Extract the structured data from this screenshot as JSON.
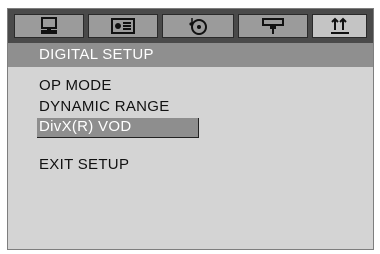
{
  "tabs": [
    {
      "name": "general-setup",
      "icon": "monitor-icon",
      "active": false
    },
    {
      "name": "audio-setup",
      "icon": "speaker-settings-icon",
      "active": false
    },
    {
      "name": "dolby-setup",
      "icon": "disc-music-icon",
      "active": false
    },
    {
      "name": "video-setup",
      "icon": "projector-icon",
      "active": false
    },
    {
      "name": "digital-setup",
      "icon": "arrows-adjust-icon",
      "active": true
    }
  ],
  "header": {
    "title": "DIGITAL SETUP"
  },
  "menu": {
    "items": [
      {
        "label": "OP MODE"
      },
      {
        "label": "DYNAMIC RANGE"
      },
      {
        "label": "DivX(R) VOD",
        "selected": true
      }
    ],
    "exit_label": "EXIT SETUP"
  },
  "colors": {
    "tab_bar": "#4a4a4a",
    "tab": "#9b9b9b",
    "tab_active": "#c4c4c4",
    "header": "#8f8f8f",
    "body": "#d4d4d4",
    "selected": "#8e8e8e"
  }
}
